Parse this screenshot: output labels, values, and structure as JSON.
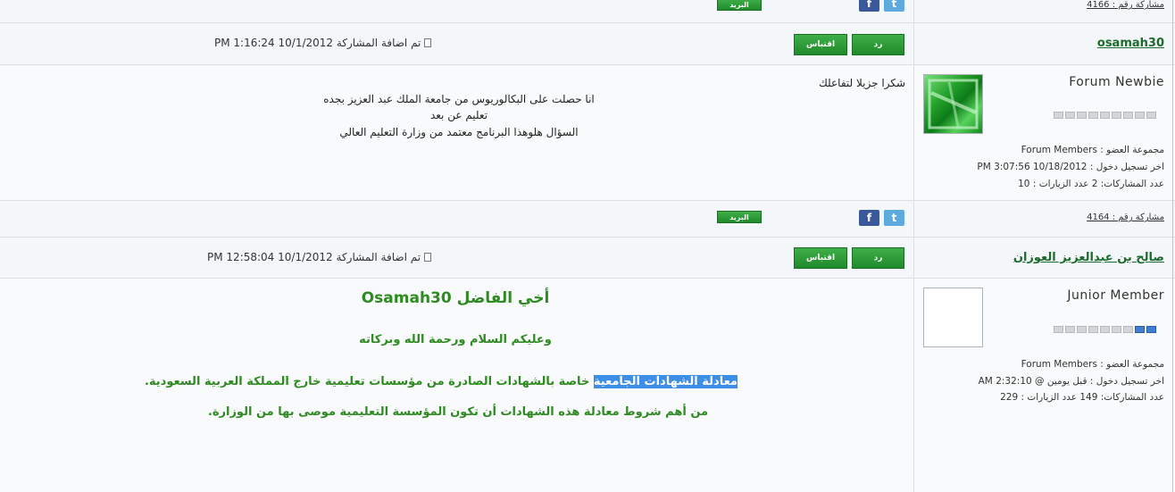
{
  "posts": [
    {
      "post_number": "مشاركة رقم : 4166",
      "mail_label": "البريد",
      "facebook_glyph": "f",
      "twitter_glyph": "t"
    },
    {
      "username": "osamah30",
      "reply_label": "رد",
      "quote_label": "اقتباس",
      "date_text": "تم اضافة المشاركة 10/1/2012 1:16:24 PM",
      "rank": "Forum Newbie",
      "stars_on": 0,
      "stars_total": 9,
      "group": "مجموعة العضو : Forum Members",
      "last_login": "اخر تسجيل دخول : 10/18/2012 3:07:56 PM",
      "stats": "عدد المشاركات: 2 عدد الزيارات : 10",
      "body_lines": [
        "شكرا جزيلا لتفاعلك",
        "انا حصلت على البكالوريوس من جامعة الملك عبد العزيز بجده",
        "تعليم عن بعد",
        "السؤال هلوهذا البرنامج معتمد من وزارة التعليم العالي"
      ],
      "post_number": "مشاركة رقم : 4164",
      "mail_label": "البريد",
      "facebook_glyph": "f",
      "twitter_glyph": "t"
    },
    {
      "username": "صالح بن عبدالعزيز العوزان",
      "reply_label": "رد",
      "quote_label": "اقتباس",
      "date_text": "تم اضافة المشاركة 10/1/2012 12:58:04 PM",
      "rank": "Junior Member",
      "stars_on": 2,
      "stars_total": 9,
      "group": "مجموعة العضو : Forum Members",
      "last_login": "اخر تسجيل دخول : قبل يومين @ 2:32:10 AM",
      "stats": "عدد المشاركات: 149 عدد الزيارات : 229",
      "greeting_prefix": "أخي الفاضل",
      "greeting_name": "Osamah30",
      "salam": "وعليكم السلام ورحمة الله وبركاته",
      "highlight": "معادلة الشهادات الجامعية",
      "line3_rest": " خاصة بالشهادات الصادرة من مؤسسات تعليمية خارج المملكة العربية السعودية.",
      "line4": "من أهم شروط معادلة هذه الشهادات أن تكون المؤسسة التعليمية موصى بها من الوزارة."
    }
  ],
  "colors": {
    "accent_green": "#2e8b21",
    "username_green": "#1c6b2c",
    "highlight_blue": "#3d8ee6",
    "facebook": "#3b5998",
    "twitter": "#5ea9dd"
  }
}
